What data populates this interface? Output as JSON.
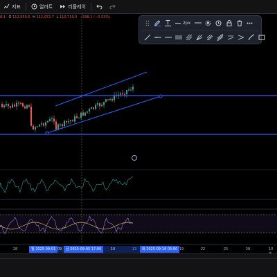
{
  "toolbar": {
    "items": [
      {
        "label": "지표"
      },
      {
        "label": "얼러트"
      },
      {
        "label": "리플레이"
      }
    ]
  },
  "legend": {
    "truncated": "8.1",
    "open_label": "O",
    "open": "112,950.0",
    "high_label": "H",
    "high": "112,072.7",
    "low_label": "L",
    "low": "112,719.0",
    "change": "−598.1 (−0.53%)"
  },
  "draw_panel": {
    "stroke_label": "2px"
  },
  "time_axis": {
    "ticks": [
      "28",
      "13",
      "19",
      "22",
      "25",
      "28",
      "10월"
    ],
    "labels": [
      "월 2025-09-01",
      "09",
      "금 2025-09-05  17:00",
      "10",
      "화 2025-09-16  05:00"
    ]
  },
  "colors": {
    "up": "#26a69a",
    "down": "#ef5350",
    "drawing": "#2962ff",
    "rsi": "#9c7dd9"
  }
}
